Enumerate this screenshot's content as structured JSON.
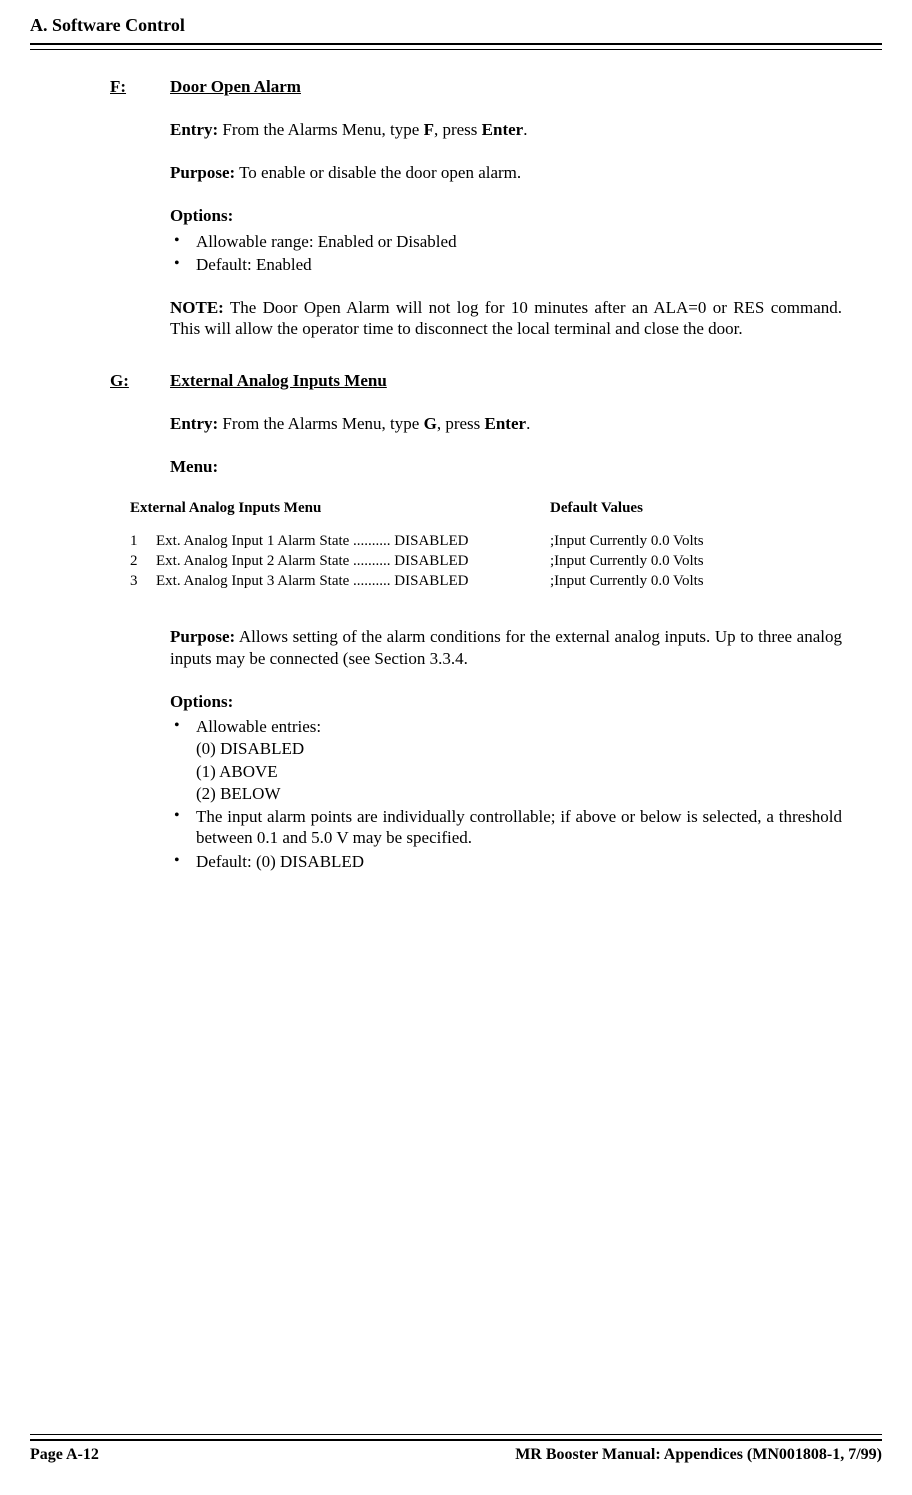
{
  "header": {
    "title": "A. Software Control"
  },
  "sectionF": {
    "key": "F:",
    "title": "Door Open Alarm",
    "entryLabel": "Entry:",
    "entryText1": " From the Alarms Menu, type ",
    "entryKey": "F",
    "entryText2": ", press ",
    "entryEnter": "Enter",
    "entryText3": ".",
    "purposeLabel": "Purpose:",
    "purposeText": " To enable or disable the door open alarm.",
    "optionsLabel": "Options:",
    "opt1": "Allowable range: Enabled or Disabled",
    "opt2": "Default: Enabled",
    "noteLabel": "NOTE:",
    "noteText": " The Door Open Alarm will not log for 10 minutes after an ALA=0 or RES command. This will allow the operator time to disconnect the local terminal and close the door."
  },
  "sectionG": {
    "key": "G:",
    "title": "External Analog Inputs Menu",
    "entryLabel": "Entry:",
    "entryText1": " From the Alarms Menu, type ",
    "entryKey": "G",
    "entryText2": ", press ",
    "entryEnter": "Enter",
    "entryText3": ".",
    "menuLabel": "Menu:",
    "menuTitle": "External Analog Inputs Menu",
    "defaultValuesLabel": "Default Values",
    "rows": [
      {
        "num": "1",
        "desc": "Ext. Analog Input 1 Alarm State .......... DISABLED",
        "val": ";Input Currently 0.0 Volts"
      },
      {
        "num": "2",
        "desc": "Ext. Analog Input 2 Alarm State .......... DISABLED",
        "val": ";Input Currently 0.0 Volts"
      },
      {
        "num": "3",
        "desc": "Ext. Analog Input 3 Alarm State .......... DISABLED",
        "val": ";Input Currently 0.0 Volts"
      }
    ],
    "purposeLabel": "Purpose:",
    "purposeText": " Allows setting of the alarm conditions for the external analog inputs. Up to three analog inputs may be connected (see Section 3.3.4.",
    "optionsLabel": "Options:",
    "opt1": "Allowable entries:",
    "sub0": "(0)  DISABLED",
    "sub1": "(1)  ABOVE",
    "sub2": "(2)  BELOW",
    "opt2": "The input alarm points are individually controllable; if above or below is selected, a threshold between 0.1 and 5.0 V may be specified.",
    "opt3": "Default: (0) DISABLED"
  },
  "footer": {
    "left": "Page A-12",
    "right": "MR Booster Manual: Appendices (MN001808-1, 7/99)"
  }
}
